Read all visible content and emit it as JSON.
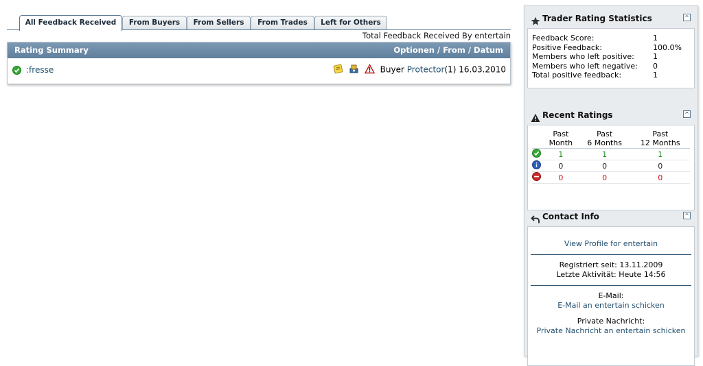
{
  "tabs": [
    {
      "label": "All Feedback Received",
      "active": true
    },
    {
      "label": "From Buyers"
    },
    {
      "label": "From Sellers"
    },
    {
      "label": "From Trades"
    },
    {
      "label": "Left for Others"
    }
  ],
  "total_feedback_line": "Total Feedback Received By entertain",
  "summary": {
    "title": "Rating Summary",
    "header_right": "Optionen / From / Datum",
    "rows": [
      {
        "rating_icon": "positive-check-icon",
        "comment": ":fresse",
        "role": "Buyer",
        "from_user": "Protector",
        "from_count": "(1)",
        "date": "16.03.2010"
      }
    ]
  },
  "sidebar": {
    "stats": {
      "title": "Trader Rating Statistics",
      "rows": [
        {
          "label": "Feedback Score:",
          "value": "1"
        },
        {
          "label": "Positive Feedback:",
          "value": "100.0%"
        },
        {
          "label": "Members who left positive:",
          "value": "1"
        },
        {
          "label": "Members who left negative:",
          "value": "0"
        },
        {
          "label": "Total positive feedback:",
          "value": "1"
        }
      ]
    },
    "recent": {
      "title": "Recent Ratings",
      "columns": [
        {
          "line1": "Past",
          "line2": "Month"
        },
        {
          "line1": "Past",
          "line2": "6 Months"
        },
        {
          "line1": "Past",
          "line2": "12 Months"
        }
      ],
      "rows": [
        {
          "type": "positive",
          "icon": "positive-check-icon",
          "values": [
            "1",
            "1",
            "1"
          ]
        },
        {
          "type": "neutral",
          "icon": "neutral-info-icon",
          "values": [
            "0",
            "0",
            "0"
          ]
        },
        {
          "type": "negative",
          "icon": "negative-minus-icon",
          "values": [
            "0",
            "0",
            "0"
          ]
        }
      ]
    },
    "contact": {
      "title": "Contact Info",
      "view_profile": "View Profile for entertain",
      "registered": "Registriert seit: 13.11.2009",
      "last_activity": "Letzte Aktivität: Heute 14:56",
      "email_label": "E-Mail:",
      "email_link": "E-Mail an entertain schicken",
      "pm_label": "Private Nachricht:",
      "pm_link": "Private Nachricht an entertain schicken"
    }
  },
  "colors": {
    "header_blue": "#5f7f9d",
    "link_blue": "#22506f",
    "positive": "#1a8a1a",
    "negative": "#d01010"
  }
}
